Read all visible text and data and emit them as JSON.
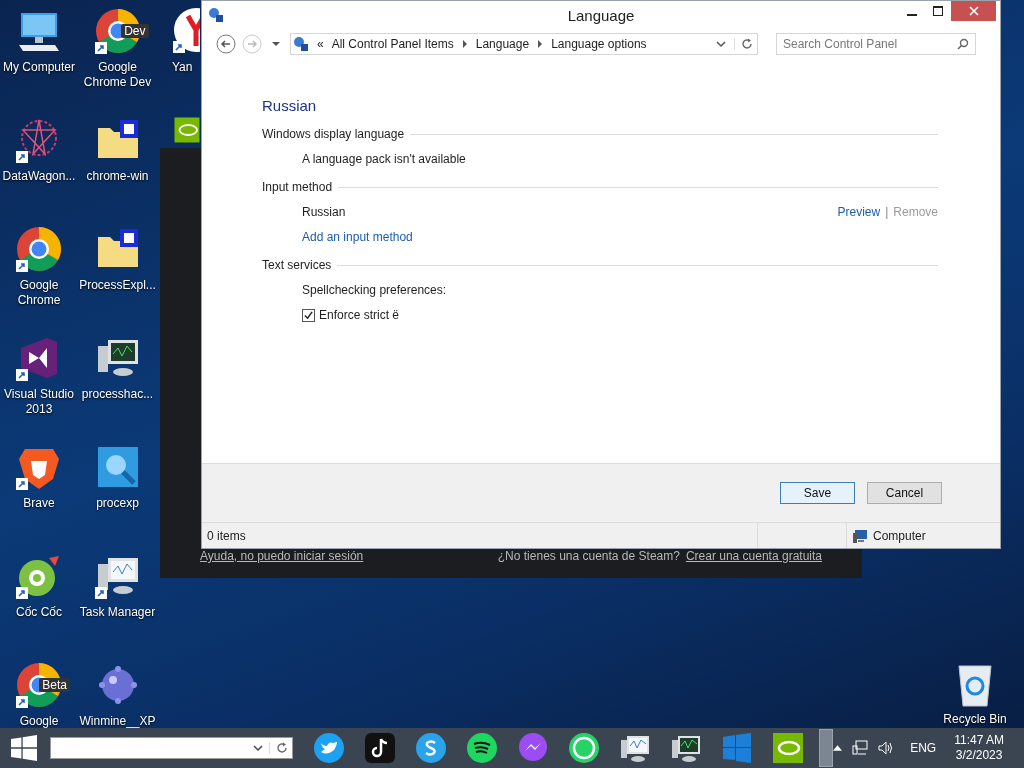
{
  "desktop_icons": [
    {
      "label": "My Computer",
      "kind": "monitor",
      "shortcut": false
    },
    {
      "label": "DataWagon...",
      "kind": "star",
      "shortcut": true
    },
    {
      "label": "Google Chrome",
      "kind": "chrome",
      "shortcut": true
    },
    {
      "label": "Visual Studio 2013",
      "kind": "vs",
      "shortcut": true
    },
    {
      "label": "Brave",
      "kind": "brave",
      "shortcut": true
    },
    {
      "label": "Cốc Cốc",
      "kind": "coccoc",
      "shortcut": true
    },
    {
      "label": "Google",
      "kind": "chrome",
      "shortcut": true,
      "badge": "Beta"
    },
    {
      "label": "Google Chrome Dev",
      "kind": "chrome",
      "shortcut": true,
      "badge": "Dev"
    },
    {
      "label": "chrome-win",
      "kind": "zip",
      "shortcut": false
    },
    {
      "label": "ProcessExpl...",
      "kind": "zip",
      "shortcut": false
    },
    {
      "label": "processhac...",
      "kind": "terminal",
      "shortcut": false
    },
    {
      "label": "procexp",
      "kind": "magnifier",
      "shortcut": false
    },
    {
      "label": "Task Manager",
      "kind": "graph",
      "shortcut": true
    },
    {
      "label": "Winmine__XP",
      "kind": "mine",
      "shortcut": false
    },
    {
      "label": "Yan",
      "kind": "yandex",
      "shortcut": true
    },
    {
      "kind": "nvidia",
      "shortcut": false
    }
  ],
  "recycle_bin": {
    "label": "Recycle Bin"
  },
  "steam_window": {
    "help_link": "Ayuda, no puedo iniciar sesión",
    "question": "¿No tienes una cuenta de Steam?",
    "signup_link": "Crear una cuenta gratuita"
  },
  "window": {
    "title": "Language",
    "breadcrumb_prefix": "«",
    "breadcrumb": [
      "All Control Panel Items",
      "Language",
      "Language options"
    ],
    "search": {
      "placeholder": "Search Control Panel"
    },
    "heading": "Russian",
    "sections": [
      {
        "title": "Windows display language",
        "items": [
          {
            "kind": "text",
            "text": "A language pack isn't available"
          }
        ]
      },
      {
        "title": "Input method",
        "items": [
          {
            "kind": "method",
            "text": "Russian",
            "actions": [
              {
                "label": "Preview",
                "disabled": false
              },
              {
                "label": "Remove",
                "disabled": true
              }
            ],
            "separator": "|"
          },
          {
            "kind": "link",
            "text": "Add an input method"
          }
        ]
      },
      {
        "title": "Text services",
        "items": [
          {
            "kind": "text",
            "text": "Spellchecking preferences:"
          },
          {
            "kind": "checkbox",
            "text": "Enforce strict ё",
            "checked": true
          }
        ]
      }
    ],
    "buttons": [
      {
        "label": "Save",
        "default": true
      },
      {
        "label": "Cancel",
        "default": false
      }
    ],
    "status": {
      "count": "0 items",
      "location": "Computer"
    }
  },
  "taskbar": {
    "apps": [
      {
        "kind": "twitter"
      },
      {
        "kind": "tiktok"
      },
      {
        "kind": "skype"
      },
      {
        "kind": "spotify"
      },
      {
        "kind": "messenger"
      },
      {
        "kind": "whatsapp"
      },
      {
        "kind": "graph"
      },
      {
        "kind": "terminal"
      },
      {
        "kind": "windows"
      },
      {
        "kind": "nvidia"
      }
    ],
    "language": "ENG",
    "time": "11:47 AM",
    "date": "3/2/2023"
  }
}
